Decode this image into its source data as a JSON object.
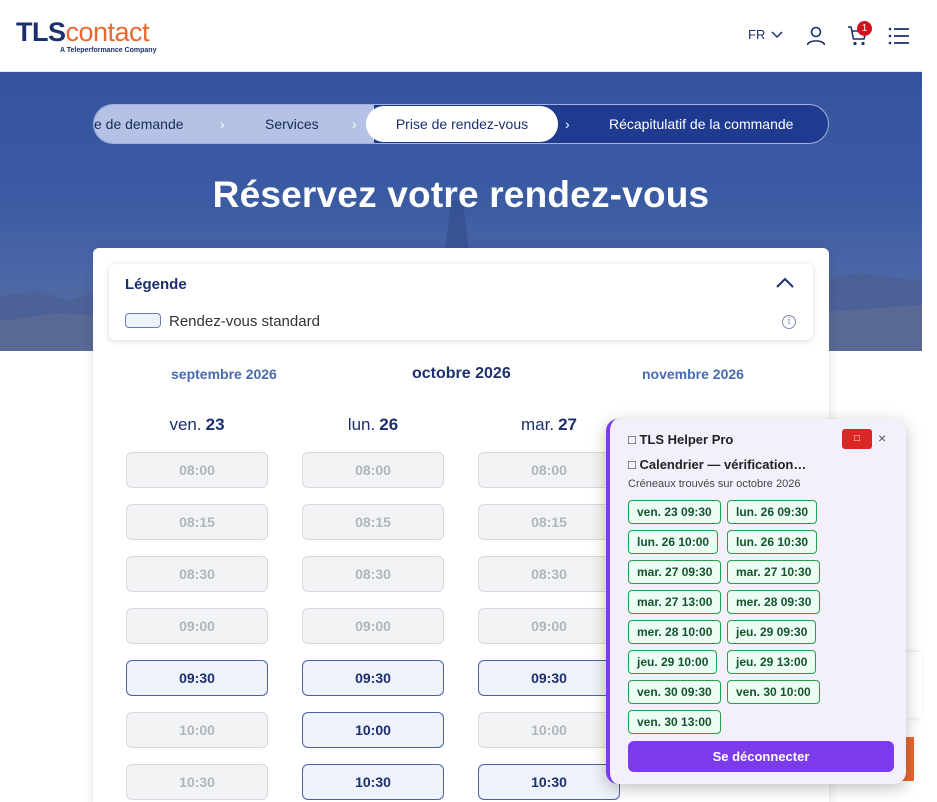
{
  "header": {
    "logo_main_tls": "TLS",
    "logo_main_contact": "contact",
    "logo_sub": "A Teleperformance Company",
    "lang": "FR",
    "cart_count": "1"
  },
  "stepper": {
    "steps": [
      {
        "label": "e de demande",
        "state": "done"
      },
      {
        "label": "Services",
        "state": "done"
      },
      {
        "label": "Prise de rendez-vous",
        "state": "active"
      },
      {
        "label": "Récapitulatif de la commande",
        "state": "pending"
      }
    ],
    "chevron": "›"
  },
  "hero": {
    "title": "Réservez votre rendez-vous"
  },
  "legend": {
    "title": "Légende",
    "standard_label": "Rendez-vous standard",
    "info_glyph": "i"
  },
  "months": {
    "prev": "septembre 2026",
    "current": "octobre 2026",
    "next": "novembre 2026"
  },
  "days": [
    {
      "weekday": "ven.",
      "day": "23",
      "slots": [
        {
          "time": "08:00",
          "available": false
        },
        {
          "time": "08:15",
          "available": false
        },
        {
          "time": "08:30",
          "available": false
        },
        {
          "time": "09:00",
          "available": false
        },
        {
          "time": "09:30",
          "available": true
        },
        {
          "time": "10:00",
          "available": false
        },
        {
          "time": "10:30",
          "available": false
        }
      ]
    },
    {
      "weekday": "lun.",
      "day": "26",
      "slots": [
        {
          "time": "08:00",
          "available": false
        },
        {
          "time": "08:15",
          "available": false
        },
        {
          "time": "08:30",
          "available": false
        },
        {
          "time": "09:00",
          "available": false
        },
        {
          "time": "09:30",
          "available": true
        },
        {
          "time": "10:00",
          "available": true
        },
        {
          "time": "10:30",
          "available": true
        }
      ]
    },
    {
      "weekday": "mar.",
      "day": "27",
      "slots": [
        {
          "time": "08:00",
          "available": false
        },
        {
          "time": "08:15",
          "available": false
        },
        {
          "time": "08:30",
          "available": false
        },
        {
          "time": "09:00",
          "available": false
        },
        {
          "time": "09:30",
          "available": true
        },
        {
          "time": "10:00",
          "available": false
        },
        {
          "time": "10:30",
          "available": true
        }
      ]
    }
  ],
  "helper": {
    "title": "□ TLS Helper Pro",
    "red_button": "□",
    "close": "×",
    "subtitle": "□ Calendrier — vérification…",
    "note": "Créneaux trouvés sur octobre 2026",
    "chips": [
      [
        "ven. 23 09:30",
        "lun. 26 09:30"
      ],
      [
        "lun. 26 10:00",
        "lun. 26 10:30"
      ],
      [
        "mar. 27 09:30",
        "mar. 27 10:30"
      ],
      [
        "mar. 27 13:00",
        "mer. 28 09:30"
      ],
      [
        "mer. 28 10:00",
        "jeu. 29 09:30"
      ],
      [
        "jeu. 29 10:00",
        "jeu. 29 13:00"
      ],
      [
        "ven. 30 09:30",
        "ven. 30 10:00"
      ],
      [
        "ven. 30 13:00"
      ]
    ],
    "logout_label": "Se déconnecter"
  },
  "colors": {
    "brand_navy": "#1c2f6e",
    "brand_orange": "#e8692f",
    "helper_purple": "#7c3aed",
    "chip_green": "#22a04b"
  }
}
